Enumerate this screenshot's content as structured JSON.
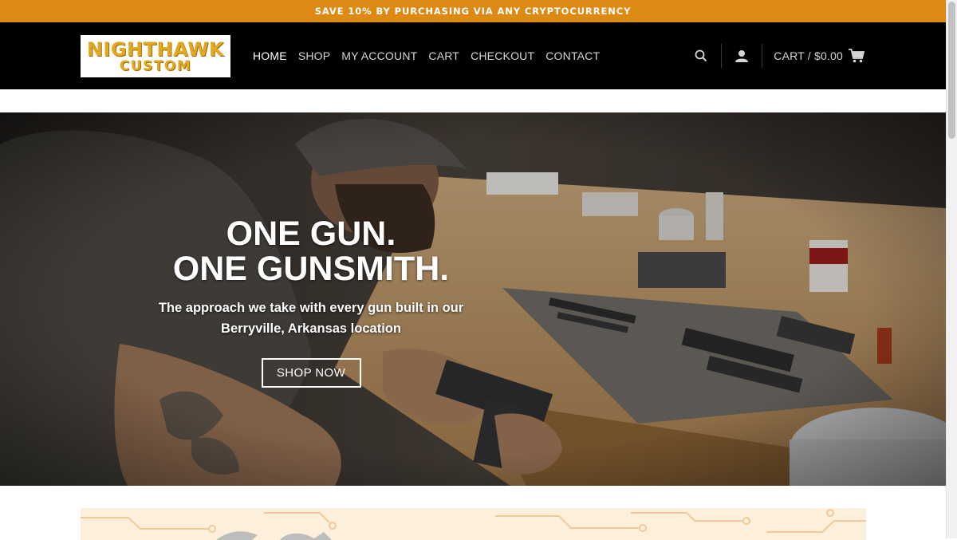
{
  "promo": {
    "text": "SAVE 10% BY PURCHASING VIA ANY CRYPTOCURRENCY"
  },
  "brand": {
    "line1": "NIGHTHAWK",
    "line2": "CUSTOM"
  },
  "nav": {
    "items": [
      {
        "label": "HOME",
        "active": true
      },
      {
        "label": "SHOP"
      },
      {
        "label": "MY ACCOUNT"
      },
      {
        "label": "CART"
      },
      {
        "label": "CHECKOUT"
      },
      {
        "label": "CONTACT"
      }
    ]
  },
  "header": {
    "search_icon": "search-icon",
    "account_icon": "user-icon",
    "cart_label": "CART / $0.00",
    "cart_icon": "shopping-cart-icon"
  },
  "hero": {
    "title_line1": "ONE GUN.",
    "title_line2": "ONE GUNSMITH.",
    "subtitle_line1": "The approach we take with every gun built in our",
    "subtitle_line2": "Berryville, Arkansas location",
    "cta_label": "SHOP NOW"
  },
  "colors": {
    "promo_bg": "#dd8a14",
    "header_bg": "#000000",
    "logo_gold": "#e3a81f",
    "banner_bg": "#fcefdc"
  }
}
